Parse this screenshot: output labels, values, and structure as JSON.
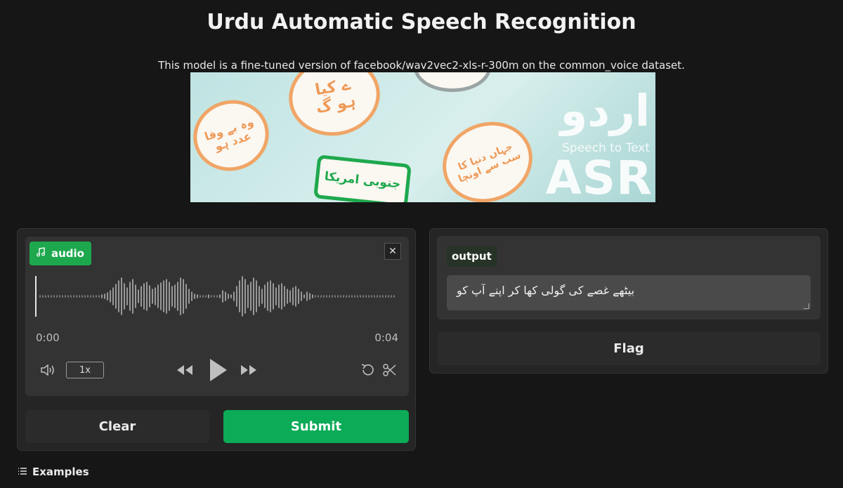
{
  "header": {
    "title": "Urdu Automatic Speech Recognition",
    "description": "This model is a fine-tuned version of facebook/wav2vec2-xls-r-300m on the common_voice dataset."
  },
  "banner": {
    "bubble_1": "وہ بے وفا\nعدد ہو",
    "bubble_2": "ے کیا\nہو گ",
    "bubble_3": "جنوبی امریکا",
    "bubble_4": "جہاں دنیا کا\nسب سے اونچا",
    "logo_urdu": "اردو",
    "logo_sub": "Speech to Text",
    "logo_asr": "ASR"
  },
  "audio": {
    "label": "audio",
    "time_start": "0:00",
    "time_end": "0:04",
    "speed": "1x"
  },
  "buttons": {
    "clear": "Clear",
    "submit": "Submit",
    "flag": "Flag"
  },
  "output": {
    "label": "output",
    "text": "بیٹھے غصے کی گولی کھا کر اپنے آپ کو"
  },
  "examples": {
    "label": "Examples"
  },
  "colors": {
    "accent_green": "#0bab57",
    "background": "#161616",
    "panel": "#252525"
  }
}
